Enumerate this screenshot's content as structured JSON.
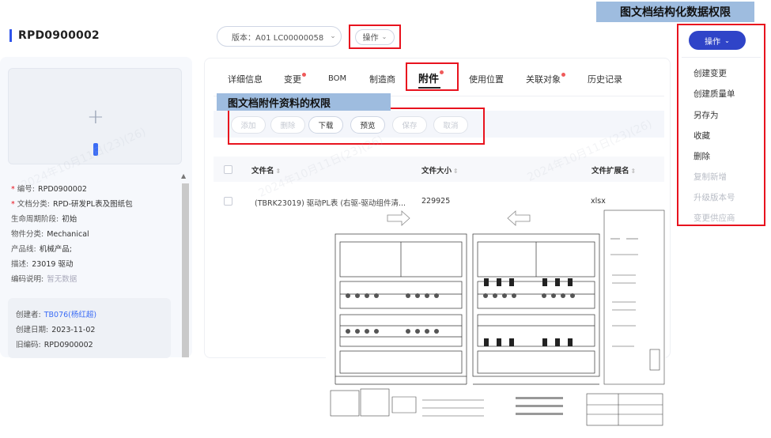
{
  "header": {
    "doc_code": "RPD0900002",
    "version_label": "版本：A01 LC00000058",
    "ops_label": "操作"
  },
  "annotations": {
    "struct_data_perm": "图文档结构化数据权限",
    "attach_perm": "图文档附件资料的权限"
  },
  "left_panel": {
    "fields": [
      {
        "label": "编号:",
        "value": "RPD0900002",
        "required": true
      },
      {
        "label": "文档分类:",
        "value": "RPD-研发PL表及图纸包",
        "required": true
      },
      {
        "label": "生命周期阶段:",
        "value": "初始",
        "required": false
      },
      {
        "label": "物件分类:",
        "value": "Mechanical",
        "required": false
      },
      {
        "label": "产品线:",
        "value": "机械产品;",
        "required": false
      },
      {
        "label": "描述:",
        "value": "23019 驱动",
        "required": false
      },
      {
        "label": "编码说明:",
        "value": "暂无数据",
        "required": false
      }
    ],
    "meta": [
      {
        "label": "创建者:",
        "value": "TB076(杨红超)"
      },
      {
        "label": "创建日期:",
        "value": "2023-11-02"
      },
      {
        "label": "旧编码:",
        "value": "RPD0900002"
      }
    ]
  },
  "tabs": [
    {
      "label": "详细信息",
      "dot": false
    },
    {
      "label": "变更",
      "dot": true
    },
    {
      "label": "BOM",
      "dot": false
    },
    {
      "label": "制造商",
      "dot": false
    },
    {
      "label": "附件",
      "dot": true,
      "active": true
    },
    {
      "label": "使用位置",
      "dot": false
    },
    {
      "label": "关联对象",
      "dot": true
    },
    {
      "label": "历史记录",
      "dot": false
    }
  ],
  "toolbar": [
    {
      "label": "添加",
      "enabled": false
    },
    {
      "label": "删除",
      "enabled": false
    },
    {
      "label": "下载",
      "enabled": true
    },
    {
      "label": "预览",
      "enabled": true
    },
    {
      "label": "保存",
      "enabled": false
    },
    {
      "label": "取消",
      "enabled": false
    }
  ],
  "table": {
    "columns": [
      "文件名",
      "文件大小",
      "文件扩展名"
    ],
    "rows": [
      {
        "name": "(TBRK23019) 驱动PL表 (右驱-驱动组件清...",
        "size": "229925",
        "ext": "xlsx"
      }
    ]
  },
  "right_menu": {
    "button_label": "操作",
    "items": [
      {
        "label": "创建变更",
        "enabled": true
      },
      {
        "label": "创建质量单",
        "enabled": true
      },
      {
        "label": "另存为",
        "enabled": true
      },
      {
        "label": "收藏",
        "enabled": true
      },
      {
        "label": "删除",
        "enabled": true
      },
      {
        "label": "复制新增",
        "enabled": false
      },
      {
        "label": "升级版本号",
        "enabled": false
      },
      {
        "label": "变更供应商",
        "enabled": false
      }
    ]
  },
  "colors": {
    "highlight_border": "#e8131e",
    "primary": "#2f44c8",
    "banner": "#9ebcdf"
  }
}
